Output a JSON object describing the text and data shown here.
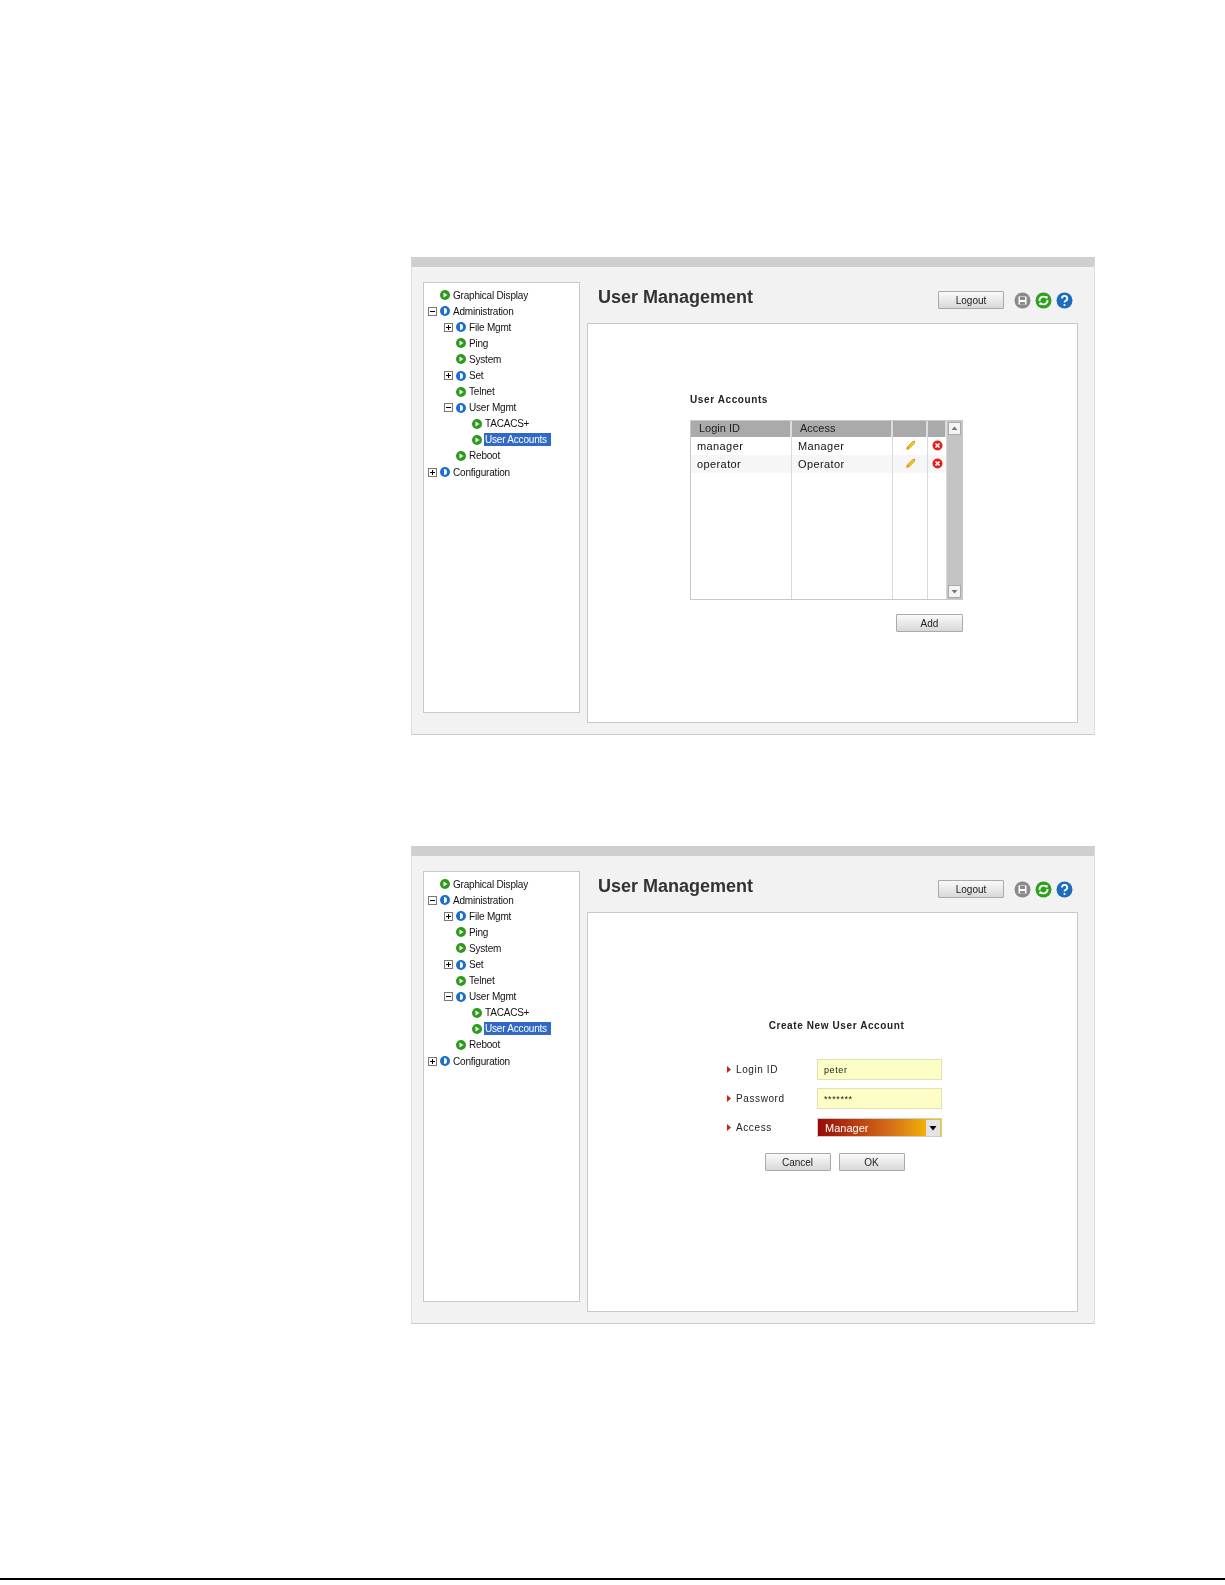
{
  "screens": [
    {
      "kind": "list",
      "title": "User Management",
      "logout_button": "Logout",
      "tree": [
        {
          "label": "Graphical Display",
          "kind": "leaf",
          "selected": false
        },
        {
          "label": "Administration",
          "kind": "branch",
          "expanded": true,
          "selected": false,
          "children": [
            {
              "label": "File Mgmt",
              "kind": "branch",
              "expanded": false,
              "selected": false
            },
            {
              "label": "Ping",
              "kind": "leaf",
              "selected": false
            },
            {
              "label": "System",
              "kind": "leaf",
              "selected": false
            },
            {
              "label": "Set",
              "kind": "branch",
              "expanded": false,
              "selected": false
            },
            {
              "label": "Telnet",
              "kind": "leaf",
              "selected": false
            },
            {
              "label": "User Mgmt",
              "kind": "branch",
              "expanded": true,
              "selected": false,
              "children": [
                {
                  "label": "TACACS+",
                  "kind": "leaf",
                  "selected": false
                },
                {
                  "label": "User Accounts",
                  "kind": "leaf",
                  "selected": true
                }
              ]
            },
            {
              "label": "Reboot",
              "kind": "leaf",
              "selected": false
            }
          ]
        },
        {
          "label": "Configuration",
          "kind": "branch",
          "expanded": false,
          "selected": false
        }
      ],
      "heading": "User Accounts",
      "table": {
        "columns": [
          "Login ID",
          "Access"
        ],
        "rows": [
          {
            "login_id": "manager",
            "access": "Manager"
          },
          {
            "login_id": "operator",
            "access": "Operator"
          }
        ]
      },
      "add_button": "Add"
    },
    {
      "kind": "form",
      "title": "User Management",
      "logout_button": "Logout",
      "tree": [
        {
          "label": "Graphical Display",
          "kind": "leaf",
          "selected": false
        },
        {
          "label": "Administration",
          "kind": "branch",
          "expanded": true,
          "selected": false,
          "children": [
            {
              "label": "File Mgmt",
              "kind": "branch",
              "expanded": false,
              "selected": false
            },
            {
              "label": "Ping",
              "kind": "leaf",
              "selected": false
            },
            {
              "label": "System",
              "kind": "leaf",
              "selected": false
            },
            {
              "label": "Set",
              "kind": "branch",
              "expanded": false,
              "selected": false
            },
            {
              "label": "Telnet",
              "kind": "leaf",
              "selected": false
            },
            {
              "label": "User Mgmt",
              "kind": "branch",
              "expanded": true,
              "selected": false,
              "children": [
                {
                  "label": "TACACS+",
                  "kind": "leaf",
                  "selected": false
                },
                {
                  "label": "User Accounts",
                  "kind": "leaf",
                  "selected": true
                }
              ]
            },
            {
              "label": "Reboot",
              "kind": "leaf",
              "selected": false
            }
          ]
        },
        {
          "label": "Configuration",
          "kind": "branch",
          "expanded": false,
          "selected": false
        }
      ],
      "heading": "Create New User Account",
      "fields": [
        {
          "kind": "text",
          "label": "Login ID",
          "value": "peter"
        },
        {
          "kind": "text",
          "label": "Password",
          "value": "*******"
        },
        {
          "kind": "select",
          "label": "Access",
          "value": "Manager"
        }
      ],
      "buttons": [
        "Cancel",
        "OK"
      ]
    }
  ]
}
